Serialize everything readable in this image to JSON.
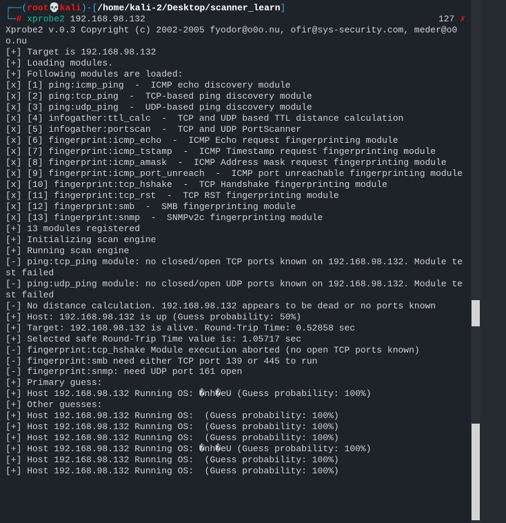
{
  "prompt": {
    "open_paren": "┌──(",
    "user": "root",
    "skull": "💀",
    "host": "kali",
    "close_paren": ")-",
    "open_bracket": "[",
    "path": "/home/kali-2/Desktop/scanner_learn",
    "close_bracket": "]",
    "line2_prefix": "└─",
    "hash": "#",
    "command": "xprobe2",
    "args": " 192.168.98.132",
    "exit_code": "127 ",
    "exit_x": "✗"
  },
  "output": {
    "blank1": "",
    "copyright": "Xprobe2 v.0.3 Copyright (c) 2002-2005 fyodor@o0o.nu, ofir@sys-security.com, meder@o0o.nu",
    "blank2": "",
    "l01": "[+] Target is 192.168.98.132",
    "l02": "[+] Loading modules.",
    "l03": "[+] Following modules are loaded:",
    "l04": "[x] [1] ping:icmp_ping  -  ICMP echo discovery module",
    "l05": "[x] [2] ping:tcp_ping  -  TCP-based ping discovery module",
    "l06": "[x] [3] ping:udp_ping  -  UDP-based ping discovery module",
    "l07": "[x] [4] infogather:ttl_calc  -  TCP and UDP based TTL distance calculation",
    "l08": "[x] [5] infogather:portscan  -  TCP and UDP PortScanner",
    "l09": "[x] [6] fingerprint:icmp_echo  -  ICMP Echo request fingerprinting module",
    "l10": "[x] [7] fingerprint:icmp_tstamp  -  ICMP Timestamp request fingerprinting module",
    "l11": "[x] [8] fingerprint:icmp_amask  -  ICMP Address mask request fingerprinting module",
    "l12": "[x] [9] fingerprint:icmp_port_unreach  -  ICMP port unreachable fingerprinting module",
    "l13": "[x] [10] fingerprint:tcp_hshake  -  TCP Handshake fingerprinting module",
    "l14": "[x] [11] fingerprint:tcp_rst  -  TCP RST fingerprinting module",
    "l15": "[x] [12] fingerprint:smb  -  SMB fingerprinting module",
    "l16": "[x] [13] fingerprint:snmp  -  SNMPv2c fingerprinting module",
    "l17": "[+] 13 modules registered",
    "l18": "[+] Initializing scan engine",
    "l19": "[+] Running scan engine",
    "l20": "[-] ping:tcp_ping module: no closed/open TCP ports known on 192.168.98.132. Module test failed",
    "l21": "[-] ping:udp_ping module: no closed/open UDP ports known on 192.168.98.132. Module test failed",
    "l22": "[-] No distance calculation. 192.168.98.132 appears to be dead or no ports known",
    "l23": "[+] Host: 192.168.98.132 is up (Guess probability: 50%)",
    "l24": "[+] Target: 192.168.98.132 is alive. Round-Trip Time: 0.52858 sec",
    "l25": "[+] Selected safe Round-Trip Time value is: 1.05717 sec",
    "l26": "[-] fingerprint:tcp_hshake Module execution aborted (no open TCP ports known)",
    "l27": "[-] fingerprint:smb need either TCP port 139 or 445 to run",
    "l28": "[-] fingerprint:snmp: need UDP port 161 open",
    "l29": "[+] Primary guess:",
    "l30": "[+] Host 192.168.98.132 Running OS: �nh�eU (Guess probability: 100%)",
    "l31": "[+] Other guesses:",
    "l32": "[+] Host 192.168.98.132 Running OS:  (Guess probability: 100%)",
    "l33": "[+] Host 192.168.98.132 Running OS:  (Guess probability: 100%)",
    "l34": "[+] Host 192.168.98.132 Running OS:  (Guess probability: 100%)",
    "l35": "[+] Host 192.168.98.132 Running OS: �nh�eU (Guess probability: 100%)",
    "l36": "[+] Host 192.168.98.132 Running OS:  (Guess probability: 100%)",
    "l37": "[+] Host 192.168.98.132 Running OS:  (Guess probability: 100%)"
  }
}
